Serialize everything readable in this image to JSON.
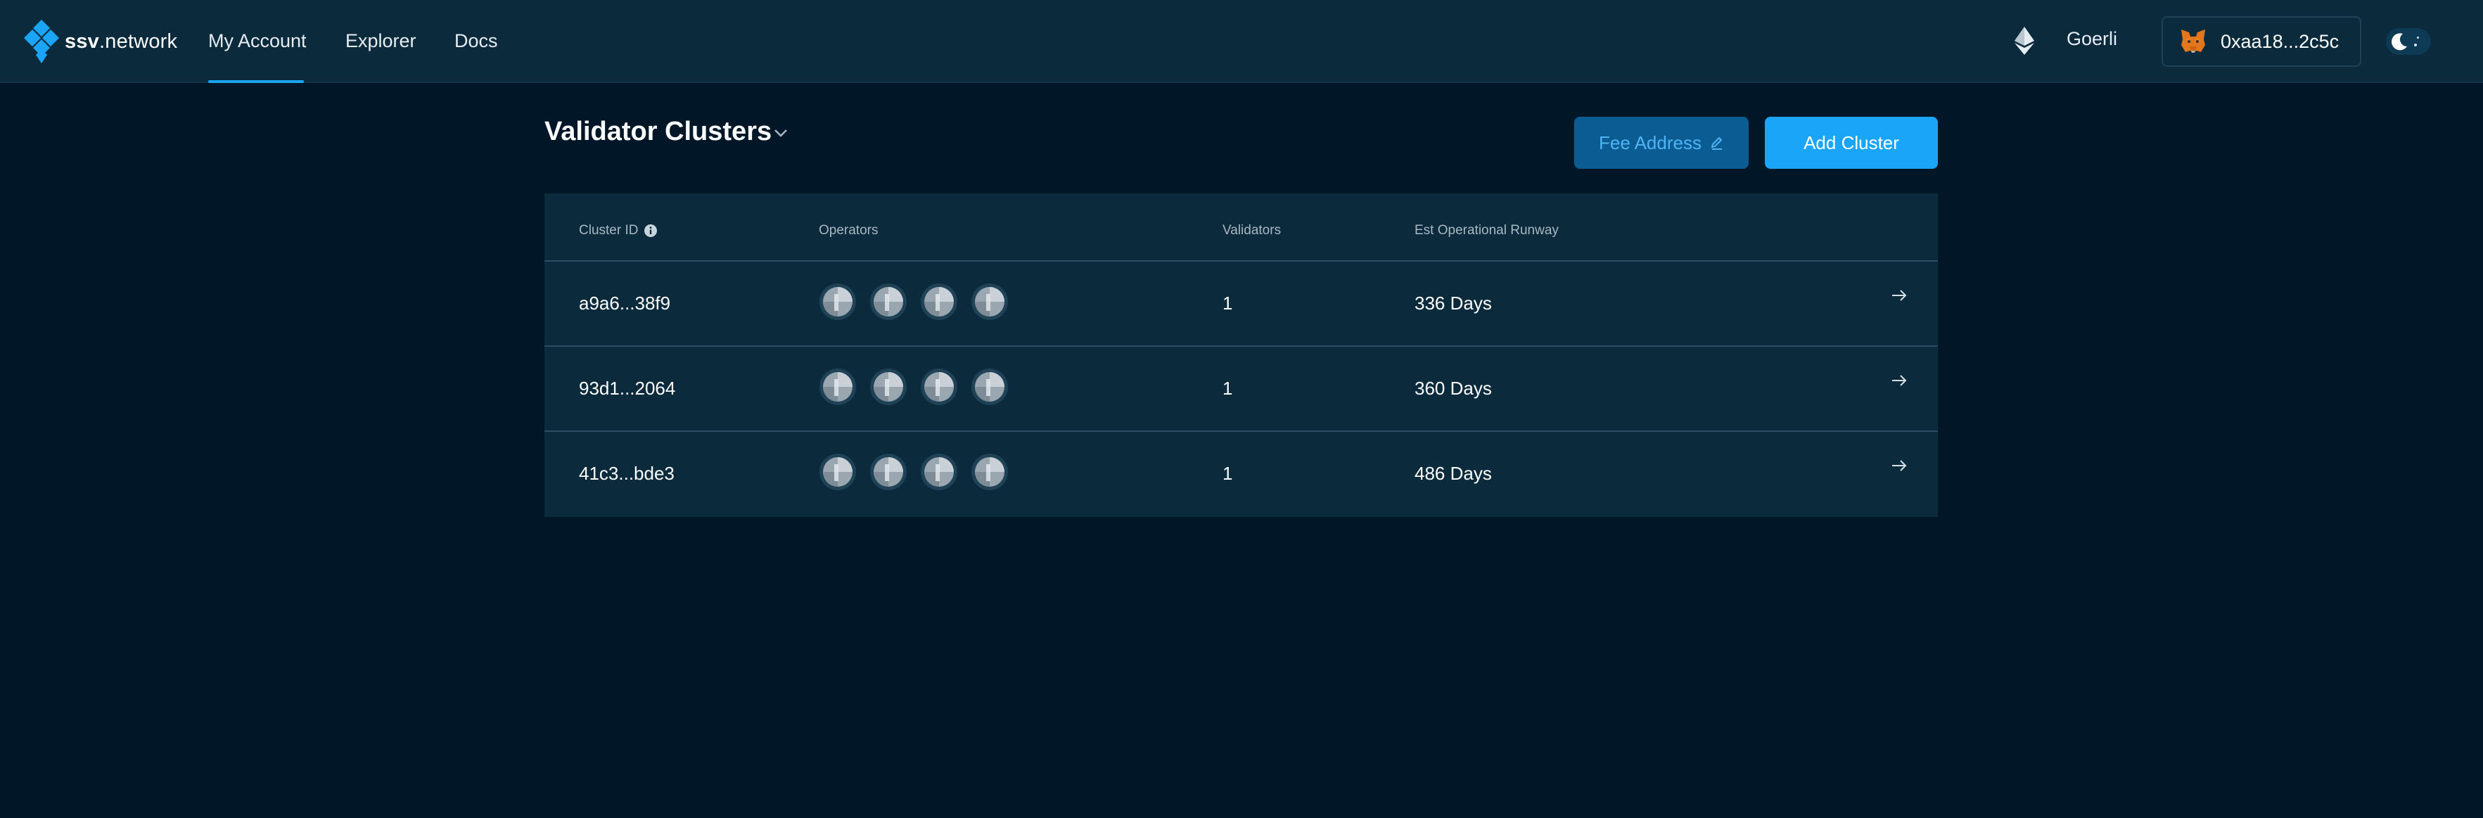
{
  "brand": {
    "logo_strong": "ssv",
    "logo_rest": ".network"
  },
  "nav": {
    "items": [
      {
        "label": "My Account",
        "active": true
      },
      {
        "label": "Explorer",
        "active": false
      },
      {
        "label": "Docs",
        "active": false
      }
    ]
  },
  "header": {
    "network_icon": "ethereum-icon",
    "network": "Goerli",
    "wallet_icon": "metamask-fox-icon",
    "wallet_address": "0xaa18...2c5c",
    "theme_toggle_icon": "moon-icon"
  },
  "page": {
    "title": "Validator Clusters",
    "title_dropdown_icon": "chevron-down-icon",
    "fee_button": "Fee Address",
    "fee_button_icon": "edit-pencil-icon",
    "add_button": "Add Cluster"
  },
  "table": {
    "columns": [
      "Cluster ID",
      "Operators",
      "Validators",
      "Est Operational Runway"
    ],
    "cluster_id_info_icon": "info-icon",
    "rows": [
      {
        "cluster_id": "a9a6...38f9",
        "operators": 4,
        "validators": "1",
        "runway": "336 Days"
      },
      {
        "cluster_id": "93d1...2064",
        "operators": 4,
        "validators": "1",
        "runway": "360 Days"
      },
      {
        "cluster_id": "41c3...bde3",
        "operators": 4,
        "validators": "1",
        "runway": "486 Days"
      }
    ],
    "row_action_icon": "arrow-right-icon"
  },
  "colors": {
    "background": "#011627",
    "surface": "#0b2a3c",
    "accent": "#1ba5f8",
    "fee_button_bg": "#0b5c93",
    "fee_button_text": "#4fb4f4"
  }
}
